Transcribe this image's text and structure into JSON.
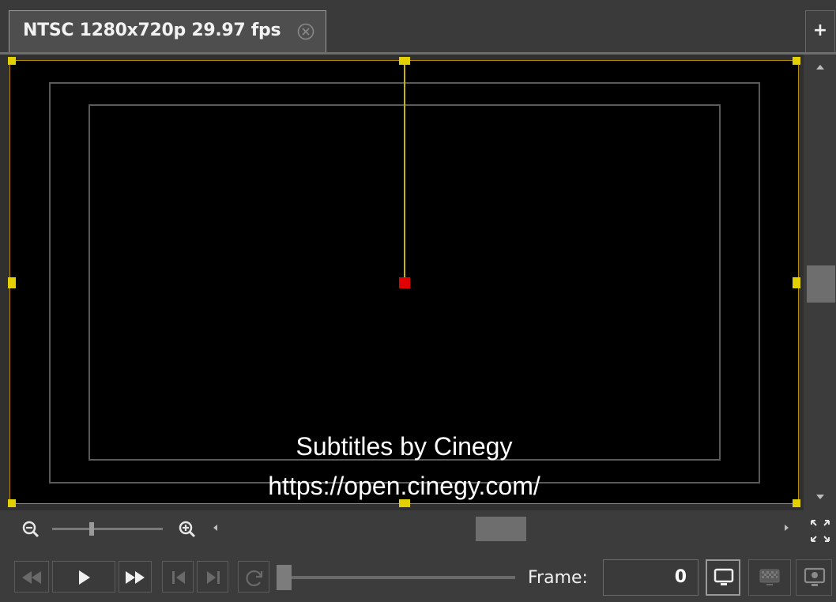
{
  "tab": {
    "title": "NTSC 1280x720p 29.97 fps"
  },
  "add_tab": {
    "label": "+"
  },
  "preview": {
    "subtitle_line1": "Subtitles by Cinegy",
    "subtitle_line2": "https://open.cinegy.com/"
  },
  "transport": {
    "frame_label": "Frame:",
    "frame_value": "0"
  },
  "icons": {
    "tab_close": "close-circle-icon",
    "zoom_out": "zoom-out-icon",
    "zoom_in": "zoom-in-icon",
    "fullscreen": "fullscreen-icon",
    "rewind": "rewind-icon",
    "play": "play-icon",
    "fast_forward": "fast-forward-icon",
    "go_start": "go-to-start-icon",
    "go_end": "go-to-end-icon",
    "loop": "loop-icon",
    "monitor": "monitor-icon",
    "checker": "checkerboard-icon",
    "external_monitor": "external-monitor-icon"
  },
  "colors": {
    "canvas_border": "#b8860b",
    "handle": "#e3d000",
    "anchor": "#e00000",
    "safe_area": "#5a5a5a"
  }
}
